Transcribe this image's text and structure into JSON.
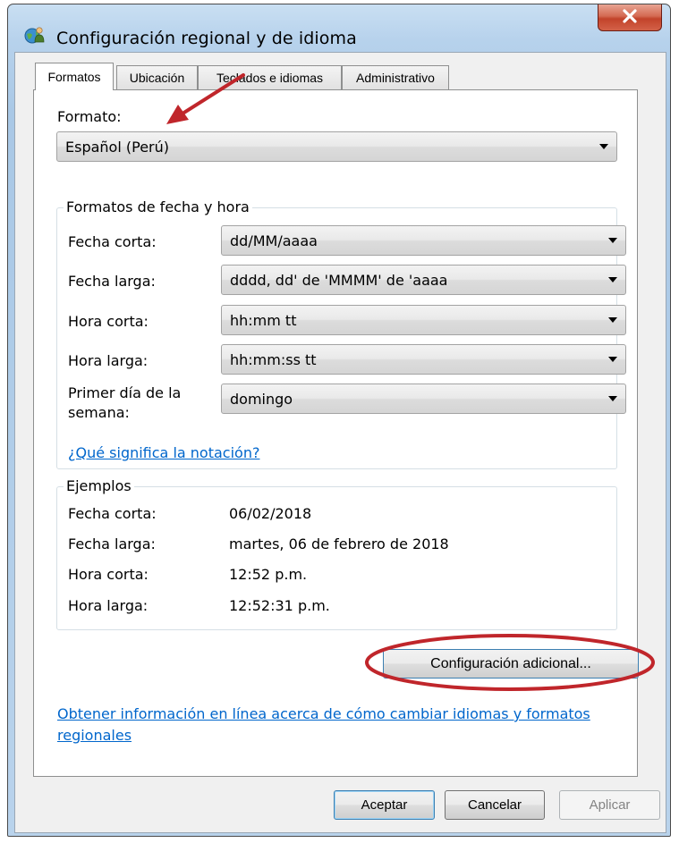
{
  "window": {
    "title": "Configuración regional y de idioma",
    "close_label": "X"
  },
  "tabs": [
    {
      "label": "Formatos",
      "active": true
    },
    {
      "label": "Ubicación",
      "active": false
    },
    {
      "label": "Teclados e idiomas",
      "active": false
    },
    {
      "label": "Administrativo",
      "active": false
    }
  ],
  "format": {
    "label": "Formato:",
    "value": "Español (Perú)"
  },
  "date_time_formats": {
    "group_title": "Formatos de fecha y hora",
    "rows": [
      {
        "label": "Fecha corta:",
        "value": "dd/MM/aaaa"
      },
      {
        "label": "Fecha larga:",
        "value": "dddd, dd' de 'MMMM' de 'aaaa"
      },
      {
        "label": "Hora corta:",
        "value": "hh:mm tt"
      },
      {
        "label": "Hora larga:",
        "value": "hh:mm:ss tt"
      }
    ],
    "first_day_label_line1": "Primer día de la",
    "first_day_label_line2": "semana:",
    "first_day_value": "domingo",
    "notation_link": "¿Qué significa la notación?"
  },
  "examples": {
    "group_title": "Ejemplos",
    "rows": [
      {
        "label": "Fecha corta:",
        "value": "06/02/2018"
      },
      {
        "label": "Fecha larga:",
        "value": "martes, 06 de febrero de 2018"
      },
      {
        "label": "Hora corta:",
        "value": "12:52 p.m."
      },
      {
        "label": "Hora larga:",
        "value": "12:52:31 p.m."
      }
    ]
  },
  "additional_settings_button": "Configuración adicional...",
  "online_info_link_line1": "Obtener información en línea acerca de cómo cambiar idiomas y formatos",
  "online_info_link_line2": "regionales",
  "footer": {
    "ok": "Aceptar",
    "cancel": "Cancelar",
    "apply": "Aplicar"
  },
  "icons": {
    "app": "globe-user-icon",
    "close": "close-icon",
    "dropdown": "chevron-down-icon"
  },
  "annotation_color": "#c0262b"
}
